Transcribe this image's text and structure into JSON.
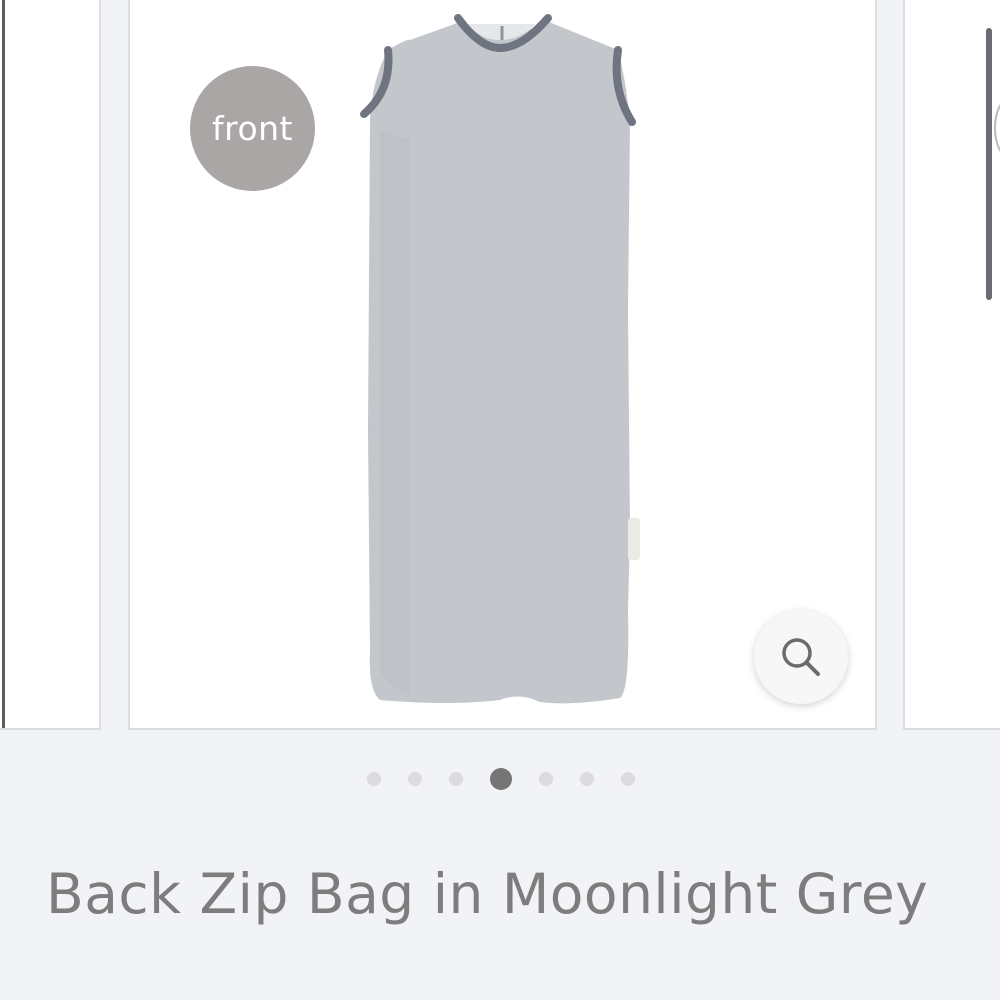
{
  "gallery": {
    "badge_label": "front",
    "image_alt": "Back Zip Bag in Moonlight Grey front view",
    "zoom_icon": "search-icon",
    "dots": {
      "total": 7,
      "active_index": 3
    }
  },
  "product": {
    "title": "Back Zip Bag in Moonlight Grey"
  },
  "colors": {
    "page_background": "#f2f3f6",
    "badge": "#aaa6a6",
    "garment": "#c3c6cb",
    "trim": "#6e7480",
    "active_dot": "#757575",
    "inactive_dot": "#dcdcdf",
    "title_text": "#7d7d7d"
  }
}
